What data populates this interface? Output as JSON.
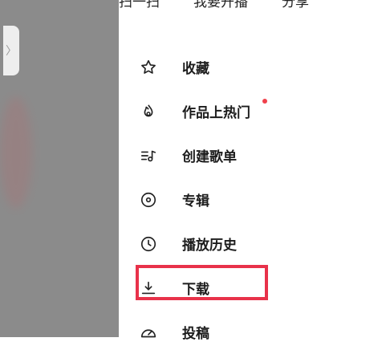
{
  "top_actions": [
    "扫一扫",
    "我要开播",
    "分享"
  ],
  "menu": [
    {
      "label": "收藏",
      "icon": "star-icon"
    },
    {
      "label": "作品上热门",
      "icon": "flame-icon",
      "badge": "red-dot"
    },
    {
      "label": "创建歌单",
      "icon": "playlist-icon"
    },
    {
      "label": "专辑",
      "icon": "disc-icon"
    },
    {
      "label": "播放历史",
      "icon": "clock-icon"
    },
    {
      "label": "下载",
      "icon": "download-icon",
      "highlighted": true
    },
    {
      "label": "投稿",
      "icon": "upload-icon"
    }
  ],
  "highlight_color": "#e8324a",
  "badge_color": "#f0414b"
}
